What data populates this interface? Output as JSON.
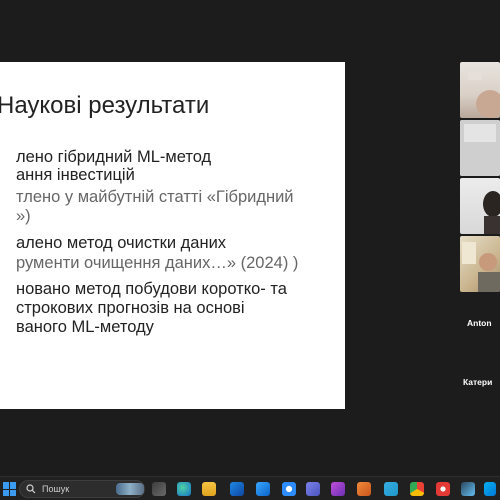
{
  "slide": {
    "title": "Наукові результати",
    "lines": [
      "лено гібридний ML-метод",
      "ання інвестицій",
      "тлено у майбутній статті «Гібридний",
      "»)",
      "алено метод очистки даних",
      "рументи очищення даних…» (2024) )",
      "новано метод побудови коротко- та",
      "строкових прогнозів на основі",
      "ваного ML-методу"
    ]
  },
  "participants": {
    "anton": "Anton",
    "katerina": "Катери"
  },
  "taskbar": {
    "search_placeholder": "Пошук",
    "icons": [
      "start-icon",
      "task-view-icon",
      "edge-icon",
      "file-explorer-icon",
      "store-icon",
      "mail-icon",
      "zoom-icon",
      "teams-icon",
      "app-icon",
      "app-icon-2",
      "telegram-icon",
      "chrome-icon",
      "skype-icon",
      "steam-icon"
    ],
    "accent": "#3a9bf0"
  }
}
